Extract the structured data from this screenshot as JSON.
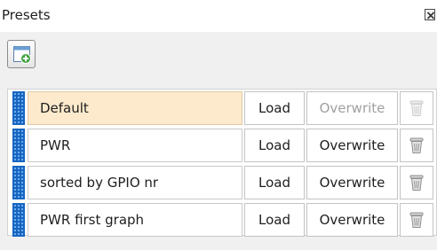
{
  "panel": {
    "title": "Presets",
    "close_icon": "close-icon"
  },
  "toolbar": {
    "new_preset_icon": "new-window-plus-icon"
  },
  "presets": [
    {
      "name": "Default",
      "load": "Load",
      "overwrite": "Overwrite",
      "selected": true,
      "overwrite_enabled": false,
      "delete_enabled": false
    },
    {
      "name": "PWR",
      "load": "Load",
      "overwrite": "Overwrite",
      "selected": false,
      "overwrite_enabled": true,
      "delete_enabled": true
    },
    {
      "name": "sorted by GPIO nr",
      "load": "Load",
      "overwrite": "Overwrite",
      "selected": false,
      "overwrite_enabled": true,
      "delete_enabled": true
    },
    {
      "name": "PWR first graph",
      "load": "Load",
      "overwrite": "Overwrite",
      "selected": false,
      "overwrite_enabled": true,
      "delete_enabled": true
    }
  ],
  "colors": {
    "selected_row": "#fdeacc",
    "grip": "#1565c0",
    "disabled_text": "#a0a0a0"
  }
}
